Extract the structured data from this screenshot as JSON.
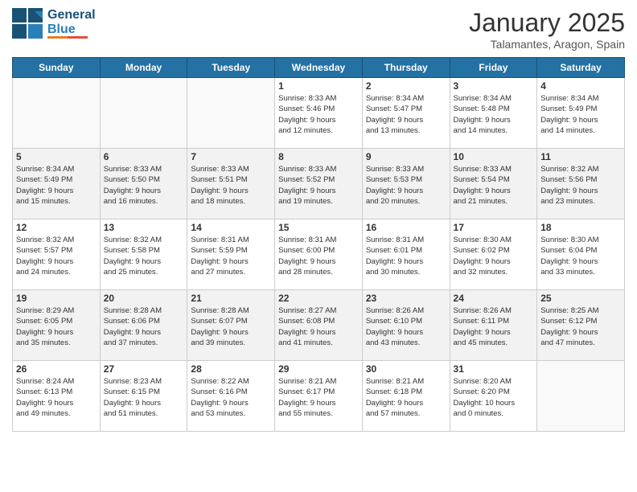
{
  "header": {
    "logo_line1": "General",
    "logo_line2": "Blue",
    "month": "January 2025",
    "location": "Talamantes, Aragon, Spain"
  },
  "weekdays": [
    "Sunday",
    "Monday",
    "Tuesday",
    "Wednesday",
    "Thursday",
    "Friday",
    "Saturday"
  ],
  "rows": [
    {
      "alt": false,
      "cells": [
        {
          "day": "",
          "content": ""
        },
        {
          "day": "",
          "content": ""
        },
        {
          "day": "",
          "content": ""
        },
        {
          "day": "1",
          "content": "Sunrise: 8:33 AM\nSunset: 5:46 PM\nDaylight: 9 hours\nand 12 minutes."
        },
        {
          "day": "2",
          "content": "Sunrise: 8:34 AM\nSunset: 5:47 PM\nDaylight: 9 hours\nand 13 minutes."
        },
        {
          "day": "3",
          "content": "Sunrise: 8:34 AM\nSunset: 5:48 PM\nDaylight: 9 hours\nand 14 minutes."
        },
        {
          "day": "4",
          "content": "Sunrise: 8:34 AM\nSunset: 5:49 PM\nDaylight: 9 hours\nand 14 minutes."
        }
      ]
    },
    {
      "alt": true,
      "cells": [
        {
          "day": "5",
          "content": "Sunrise: 8:34 AM\nSunset: 5:49 PM\nDaylight: 9 hours\nand 15 minutes."
        },
        {
          "day": "6",
          "content": "Sunrise: 8:33 AM\nSunset: 5:50 PM\nDaylight: 9 hours\nand 16 minutes."
        },
        {
          "day": "7",
          "content": "Sunrise: 8:33 AM\nSunset: 5:51 PM\nDaylight: 9 hours\nand 18 minutes."
        },
        {
          "day": "8",
          "content": "Sunrise: 8:33 AM\nSunset: 5:52 PM\nDaylight: 9 hours\nand 19 minutes."
        },
        {
          "day": "9",
          "content": "Sunrise: 8:33 AM\nSunset: 5:53 PM\nDaylight: 9 hours\nand 20 minutes."
        },
        {
          "day": "10",
          "content": "Sunrise: 8:33 AM\nSunset: 5:54 PM\nDaylight: 9 hours\nand 21 minutes."
        },
        {
          "day": "11",
          "content": "Sunrise: 8:32 AM\nSunset: 5:56 PM\nDaylight: 9 hours\nand 23 minutes."
        }
      ]
    },
    {
      "alt": false,
      "cells": [
        {
          "day": "12",
          "content": "Sunrise: 8:32 AM\nSunset: 5:57 PM\nDaylight: 9 hours\nand 24 minutes."
        },
        {
          "day": "13",
          "content": "Sunrise: 8:32 AM\nSunset: 5:58 PM\nDaylight: 9 hours\nand 25 minutes."
        },
        {
          "day": "14",
          "content": "Sunrise: 8:31 AM\nSunset: 5:59 PM\nDaylight: 9 hours\nand 27 minutes."
        },
        {
          "day": "15",
          "content": "Sunrise: 8:31 AM\nSunset: 6:00 PM\nDaylight: 9 hours\nand 28 minutes."
        },
        {
          "day": "16",
          "content": "Sunrise: 8:31 AM\nSunset: 6:01 PM\nDaylight: 9 hours\nand 30 minutes."
        },
        {
          "day": "17",
          "content": "Sunrise: 8:30 AM\nSunset: 6:02 PM\nDaylight: 9 hours\nand 32 minutes."
        },
        {
          "day": "18",
          "content": "Sunrise: 8:30 AM\nSunset: 6:04 PM\nDaylight: 9 hours\nand 33 minutes."
        }
      ]
    },
    {
      "alt": true,
      "cells": [
        {
          "day": "19",
          "content": "Sunrise: 8:29 AM\nSunset: 6:05 PM\nDaylight: 9 hours\nand 35 minutes."
        },
        {
          "day": "20",
          "content": "Sunrise: 8:28 AM\nSunset: 6:06 PM\nDaylight: 9 hours\nand 37 minutes."
        },
        {
          "day": "21",
          "content": "Sunrise: 8:28 AM\nSunset: 6:07 PM\nDaylight: 9 hours\nand 39 minutes."
        },
        {
          "day": "22",
          "content": "Sunrise: 8:27 AM\nSunset: 6:08 PM\nDaylight: 9 hours\nand 41 minutes."
        },
        {
          "day": "23",
          "content": "Sunrise: 8:26 AM\nSunset: 6:10 PM\nDaylight: 9 hours\nand 43 minutes."
        },
        {
          "day": "24",
          "content": "Sunrise: 8:26 AM\nSunset: 6:11 PM\nDaylight: 9 hours\nand 45 minutes."
        },
        {
          "day": "25",
          "content": "Sunrise: 8:25 AM\nSunset: 6:12 PM\nDaylight: 9 hours\nand 47 minutes."
        }
      ]
    },
    {
      "alt": false,
      "cells": [
        {
          "day": "26",
          "content": "Sunrise: 8:24 AM\nSunset: 6:13 PM\nDaylight: 9 hours\nand 49 minutes."
        },
        {
          "day": "27",
          "content": "Sunrise: 8:23 AM\nSunset: 6:15 PM\nDaylight: 9 hours\nand 51 minutes."
        },
        {
          "day": "28",
          "content": "Sunrise: 8:22 AM\nSunset: 6:16 PM\nDaylight: 9 hours\nand 53 minutes."
        },
        {
          "day": "29",
          "content": "Sunrise: 8:21 AM\nSunset: 6:17 PM\nDaylight: 9 hours\nand 55 minutes."
        },
        {
          "day": "30",
          "content": "Sunrise: 8:21 AM\nSunset: 6:18 PM\nDaylight: 9 hours\nand 57 minutes."
        },
        {
          "day": "31",
          "content": "Sunrise: 8:20 AM\nSunset: 6:20 PM\nDaylight: 10 hours\nand 0 minutes."
        },
        {
          "day": "",
          "content": ""
        }
      ]
    }
  ]
}
